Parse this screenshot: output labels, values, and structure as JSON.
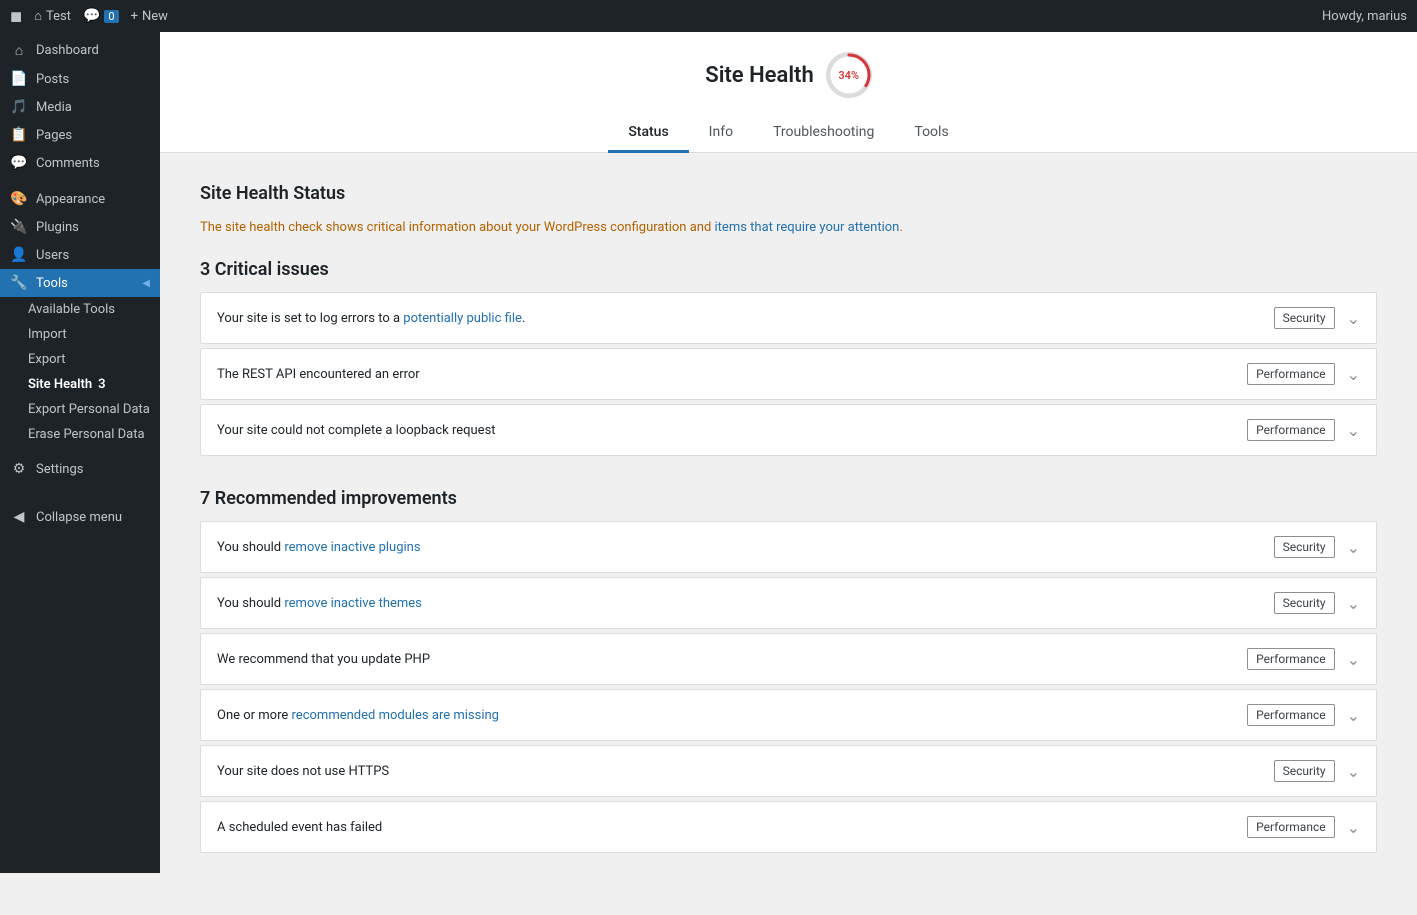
{
  "topbar": {
    "wp_logo": "⊞",
    "site_name": "Test",
    "comments_label": "Comments",
    "comments_count": "0",
    "new_label": "New",
    "howdy": "Howdy, marius"
  },
  "sidebar": {
    "items": [
      {
        "id": "dashboard",
        "label": "Dashboard",
        "icon": "⌂"
      },
      {
        "id": "posts",
        "label": "Posts",
        "icon": "📄"
      },
      {
        "id": "media",
        "label": "Media",
        "icon": "🖼"
      },
      {
        "id": "pages",
        "label": "Pages",
        "icon": "📋"
      },
      {
        "id": "comments",
        "label": "Comments",
        "icon": "💬"
      },
      {
        "id": "appearance",
        "label": "Appearance",
        "icon": "🎨"
      },
      {
        "id": "plugins",
        "label": "Plugins",
        "icon": "🔌"
      },
      {
        "id": "users",
        "label": "Users",
        "icon": "👤"
      },
      {
        "id": "tools",
        "label": "Tools",
        "icon": "🔧",
        "active": true
      }
    ],
    "tools_submenu": [
      {
        "id": "available-tools",
        "label": "Available Tools"
      },
      {
        "id": "import",
        "label": "Import"
      },
      {
        "id": "export",
        "label": "Export"
      },
      {
        "id": "site-health",
        "label": "Site Health",
        "badge": "3",
        "active": true
      },
      {
        "id": "export-personal-data",
        "label": "Export Personal Data"
      },
      {
        "id": "erase-personal-data",
        "label": "Erase Personal Data"
      }
    ],
    "settings": {
      "label": "Settings",
      "icon": "⚙"
    },
    "collapse": {
      "label": "Collapse menu",
      "icon": "◀"
    }
  },
  "page": {
    "title": "Site Health",
    "health_percent": "34%",
    "tabs": [
      {
        "id": "status",
        "label": "Status",
        "active": true
      },
      {
        "id": "info",
        "label": "Info"
      },
      {
        "id": "troubleshooting",
        "label": "Troubleshooting"
      },
      {
        "id": "tools",
        "label": "Tools"
      }
    ],
    "section_title": "Site Health Status",
    "description": "The site health check shows critical information about your WordPress configuration and items that require your attention.",
    "critical_label": "3 Critical issues",
    "critical_issues": [
      {
        "id": "log-errors",
        "text_before": "Your site is set to log errors to a ",
        "link_text": "potentially public file",
        "text_after": ".",
        "badge": "Security"
      },
      {
        "id": "rest-api",
        "text_before": "The REST API encountered an error",
        "link_text": "",
        "text_after": "",
        "badge": "Performance"
      },
      {
        "id": "loopback",
        "text_before": "Your site could not complete a loopback request",
        "link_text": "",
        "text_after": "",
        "badge": "Performance"
      }
    ],
    "recommended_label": "7 Recommended improvements",
    "recommended_issues": [
      {
        "id": "inactive-plugins",
        "text_before": "You should ",
        "link_text": "remove inactive plugins",
        "text_after": "",
        "badge": "Security"
      },
      {
        "id": "inactive-themes",
        "text_before": "You should ",
        "link_text": "remove inactive themes",
        "text_after": "",
        "badge": "Security"
      },
      {
        "id": "update-php",
        "text_before": "We recommend that you update PHP",
        "link_text": "",
        "text_after": "",
        "badge": "Performance"
      },
      {
        "id": "missing-modules",
        "text_before": "One or more ",
        "link_text": "recommended modules are missing",
        "text_after": "",
        "badge": "Performance"
      },
      {
        "id": "no-https",
        "text_before": "Your site does not use HTTPS",
        "link_text": "",
        "text_after": "",
        "badge": "Security"
      },
      {
        "id": "scheduled-event",
        "text_before": "A scheduled event has failed",
        "link_text": "",
        "text_after": "",
        "badge": "Performance"
      }
    ]
  }
}
